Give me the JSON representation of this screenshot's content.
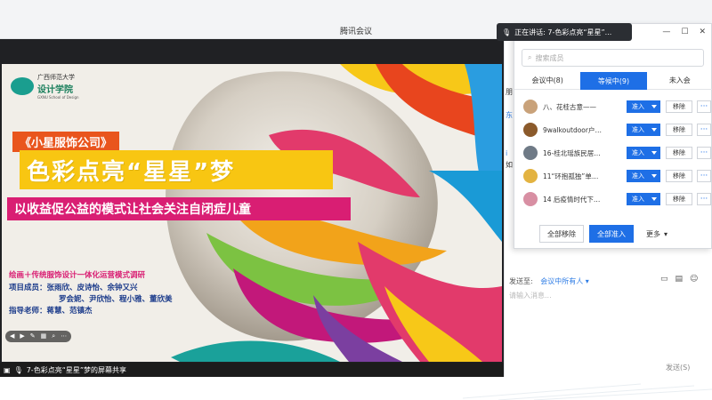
{
  "window": {
    "title": "腾讯会议"
  },
  "speaking": {
    "label": "正在讲话: 7-色彩点亮“星星”..."
  },
  "share": {
    "label": "7-色彩点亮“星星”梦的屏幕共享"
  },
  "slide": {
    "logo_cn": "广西师范大学",
    "logo_name": "设计学院",
    "logo_en": "GXNU School of Design",
    "company": "《小星服饰公司》",
    "title": "色彩点亮“星星”梦",
    "subtitle": "以收益促公益的模式让社会关注自闭症儿童",
    "subline": "绘画＋传统服饰设计一体化运营模式调研",
    "members_line1": "项目成员：张雨欣、皮诗怡、余钟又兴",
    "members_line2": "罗会妮、尹欣怡、程小雅、董欣美",
    "advisors": "指导老师：蒋慧、范镇杰"
  },
  "panel": {
    "search_placeholder": "搜索成员",
    "tabs": [
      {
        "label": "会议中(8)"
      },
      {
        "label": "等候中(9)"
      },
      {
        "label": "未入会"
      }
    ],
    "admit_label": "准入",
    "remove_label": "移除",
    "more_label": "···",
    "rows": [
      {
        "name": "八、花桂古意——",
        "avatar_color": "#c9a27a"
      },
      {
        "name": "9walkoutdoor户…",
        "avatar_color": "#8b5a2b"
      },
      {
        "name": "16-桂北瑶族民居…",
        "avatar_color": "#6f7a86"
      },
      {
        "name": "11“环抱孤独”单…",
        "avatar_color": "#e3b341"
      },
      {
        "name": "14 后疫情时代下…",
        "avatar_color": "#d88fa3"
      }
    ],
    "footer": {
      "remove_all": "全部移除",
      "admit_all": "全部准入",
      "more": "更多"
    }
  },
  "chat": {
    "sendto_label": "发送至:",
    "sendto_target": "会议中所有人",
    "input_placeholder": "请输入消息...",
    "send_label": "发送(S)"
  },
  "partial_text": {
    "a": "朋",
    "b": "东",
    "c": "i",
    "d": "如"
  }
}
